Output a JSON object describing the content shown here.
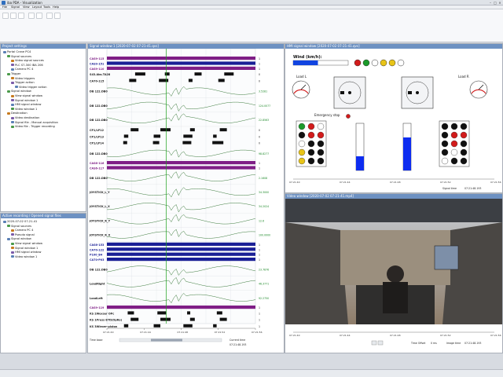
{
  "window": {
    "title": "iba PDA - Visualization"
  },
  "menu": [
    "File",
    "Signal",
    "View",
    "Layout",
    "Tools",
    "Help"
  ],
  "project_panel": {
    "title": "Project settings",
    "items": [
      {
        "label": "Portal Crane PC4",
        "level": 0
      },
      {
        "label": "Signal sources",
        "level": 1
      },
      {
        "label": "Video signal sources",
        "level": 2
      },
      {
        "label": "PLC S7-300 IBA 206",
        "level": 2
      },
      {
        "label": "Camera PC 4",
        "level": 2
      },
      {
        "label": "Trigger",
        "level": 1
      },
      {
        "label": "Video triggers",
        "level": 2
      },
      {
        "label": "Trigger action",
        "level": 2
      },
      {
        "label": "Video trigger action",
        "level": 3
      },
      {
        "label": "Signal window",
        "level": 1
      },
      {
        "label": "View signal window",
        "level": 2
      },
      {
        "label": "Signal window 1",
        "level": 2
      },
      {
        "label": "HMI signal window",
        "level": 2
      },
      {
        "label": "Video window 1",
        "level": 2
      },
      {
        "label": "Destination",
        "level": 1
      },
      {
        "label": "Video destination",
        "level": 2
      },
      {
        "label": "Signal file - Manual acquisition",
        "level": 2
      },
      {
        "label": "Video file - Trigger recording",
        "level": 2
      }
    ]
  },
  "recording_panel": {
    "title": "Active recording / Opened signal files",
    "items": [
      {
        "label": "2020-07-02 07-21-41",
        "level": 0
      },
      {
        "label": "Signal sources",
        "level": 1
      },
      {
        "label": "Camera PC 4",
        "level": 2
      },
      {
        "label": "Pseudo signal",
        "level": 2
      },
      {
        "label": "Signal window",
        "level": 1
      },
      {
        "label": "View signal window",
        "level": 2
      },
      {
        "label": "Signal window 1",
        "level": 2
      },
      {
        "label": "HMI signal window",
        "level": 2
      },
      {
        "label": "Video window 1",
        "level": 2
      }
    ]
  },
  "signal_window": {
    "title": "Signal window 1 [2020-07-02 07-21-41.qvs]",
    "cursor_time": "07:21:48.193",
    "rows": [
      {
        "label": "CAS9-115",
        "value": "1",
        "kind": "purple"
      },
      {
        "label": "CAS9-151",
        "value": "1",
        "kind": "blue"
      },
      {
        "label": "CAS9-110",
        "value": "1",
        "kind": "purple"
      },
      {
        "label": "S43.Abs.TA28",
        "value": "0",
        "kind": "bits"
      },
      {
        "label": "CA70-115",
        "value": "0",
        "kind": "bits"
      },
      {
        "label": "DB 122.DB0",
        "value": "3.5281",
        "kind": "analog"
      },
      {
        "label": "DB 122.DB0",
        "value": "124.0077",
        "kind": "analog"
      },
      {
        "label": "DB 122.DB0",
        "value": "22.8563",
        "kind": "analog"
      },
      {
        "label": "CP1/LP12",
        "value": "0",
        "kind": "bits"
      },
      {
        "label": "CP1/LP13",
        "value": "0",
        "kind": "bits"
      },
      {
        "label": "CP1/LP14",
        "value": "0",
        "kind": "bits"
      },
      {
        "label": "DB 122.DB0",
        "value": "98.8277",
        "kind": "analog"
      },
      {
        "label": "CAS6-116",
        "value": "1",
        "kind": "purple"
      },
      {
        "label": "CAS6-117",
        "value": "1",
        "kind": "purple"
      },
      {
        "label": "DB 122.DB0",
        "value": "2.1608",
        "kind": "analog"
      },
      {
        "label": "JOYSTICK_L_Y",
        "value": "34.3000",
        "kind": "analog"
      },
      {
        "label": "JOYSTICK_L_X",
        "value": "34.2024",
        "kind": "analog"
      },
      {
        "label": "JOYSTICK_R_Y",
        "value": "12.6",
        "kind": "analog"
      },
      {
        "label": "JOYSTICK_R_X",
        "value": "100.0000",
        "kind": "analog"
      },
      {
        "label": "CAS6-153",
        "value": "1",
        "kind": "blue"
      },
      {
        "label": "CA70-122",
        "value": "1",
        "kind": "blue"
      },
      {
        "label": "P100_B4",
        "value": "1",
        "kind": "blue"
      },
      {
        "label": "CA70-P03",
        "value": "1",
        "kind": "blue"
      },
      {
        "label": "DB 122.DB0",
        "value": "23.7876",
        "kind": "analog"
      },
      {
        "label": "LoadRight",
        "value": "46.3771",
        "kind": "analog"
      },
      {
        "label": "LoadLeft",
        "value": "92.2750",
        "kind": "analog"
      },
      {
        "label": "CAS9-119",
        "value": "1",
        "kind": "purple"
      },
      {
        "label": "KS 2Wexser OPc",
        "value": "1",
        "kind": "bits"
      },
      {
        "label": "KS 1Press 87D(OpRo)",
        "value": "1",
        "kind": "bits"
      },
      {
        "label": "KS 3Wlexer-piston",
        "value": "1",
        "kind": "bits"
      }
    ],
    "time_ticks": [
      "07:21:40",
      "07:21:44",
      "07:21:48",
      "07:21:52",
      "07:21:56"
    ],
    "time_base_label": "Time base",
    "current_time_label": "Current time",
    "current_time_value": "07:21:48.193"
  },
  "graphics_window": {
    "title": "HMI signal window [2020-07-02 07-21-41.qvs]",
    "wind_label": "Wind (km/h):",
    "load_left_label": "Load L",
    "load_right_label": "Load R",
    "emergency_label": "Emergency stop",
    "wind_level": 0.45,
    "load_left_level": 0.3,
    "load_right_level": 0.7,
    "time_ticks": [
      "07:21:40",
      "07:21:44",
      "07:21:48",
      "07:21:52",
      "07:21:56"
    ],
    "signal_time_label": "Signal time",
    "signal_time_value": "07:21:48.193"
  },
  "video_window": {
    "title": "Video window [2020-07-02 07-21-41.mp4]",
    "time_ticks": [
      "07:21:40",
      "07:21:44",
      "07:21:48",
      "07:21:52",
      "07:21:56"
    ],
    "time_label": "Time Offset",
    "time_value": "0 ms",
    "image_time_label": "Image time",
    "image_time_value": "07:21:48.193"
  },
  "colors": {
    "accent": "#6d91c2",
    "purple": "#7f1e86",
    "blue": "#1a1f96",
    "green": "#1e8a2a",
    "signal_line": "#3a7a3a",
    "wind_bar": "#1144e0",
    "load_bar": "#0d2cf0"
  }
}
